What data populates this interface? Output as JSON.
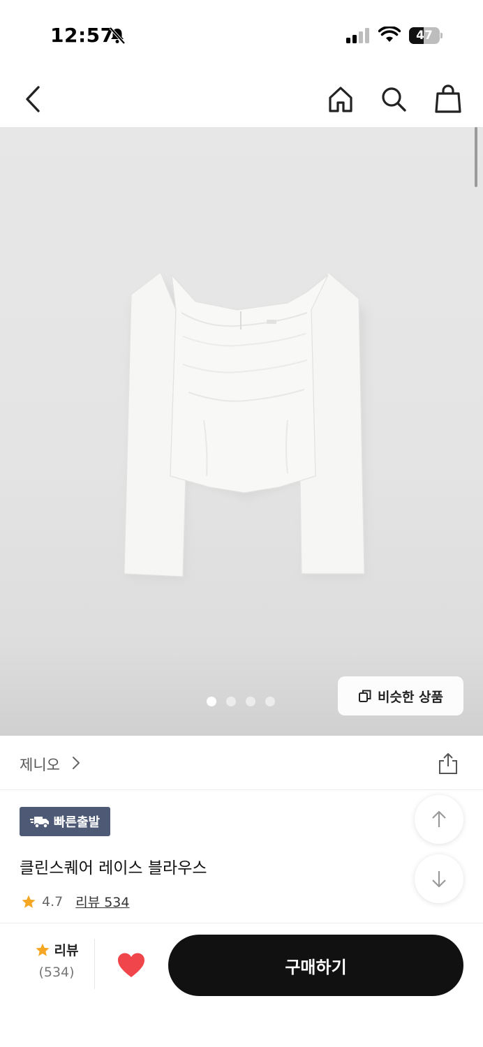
{
  "status_bar": {
    "time": "12:57",
    "battery": "47",
    "battery_level": 0.47
  },
  "nav": {
    "icons": [
      "back-chevron-icon",
      "home-icon",
      "search-icon",
      "shopping-bag-icon"
    ]
  },
  "gallery": {
    "page_count": 4,
    "active_index": 0,
    "similar_button_label": "비슷한 상품"
  },
  "brand": {
    "name": "제니오"
  },
  "product": {
    "badge_label": "빠른출발",
    "title": "클린스퀘어 레이스 블라우스",
    "rating": "4.7",
    "review_link": "리뷰 534"
  },
  "bottom_bar": {
    "review_label": "리뷰",
    "review_count": "(534)",
    "buy_label": "구매하기"
  },
  "colors": {
    "badge": "#4e5a75",
    "star": "#f5a623",
    "heart": "#f0454a",
    "buy_button": "#111111"
  }
}
